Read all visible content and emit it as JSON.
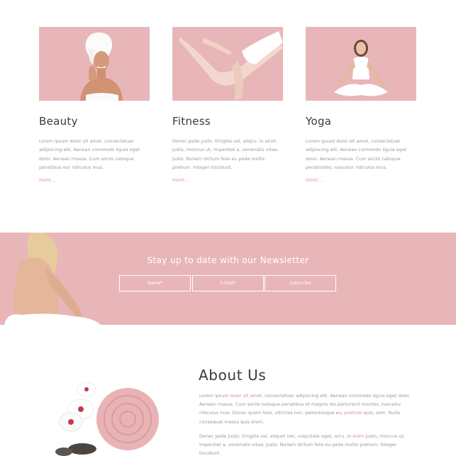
{
  "services": [
    {
      "title": "Beauty",
      "text": "Lorem ipsum dolor sit amet, consectetuer adipiscing elit. Aenean commodo ligula eget dolor. Aenean massa. Cum sociis natoque penatibus eur ridiculus mus.",
      "more": "more..."
    },
    {
      "title": "Fitness",
      "text": "Donec pede justo, fringilla vel, aliqcu. In enim justo, rhoncus ut, imperdiet a, venenatis vitae, justo. Nullam dictum felis eu pede mollis pretium. Integer tincidunt.",
      "more": "more..."
    },
    {
      "title": "Yoga",
      "text": "Lorem ipsum dolor sit amet, consectetuer adipiscing elit. Aenean commodo ligula eget dolor. Aenean massa. Cum sociis natoque penatontes; nascetur ridiculus mus.",
      "more": "more..."
    }
  ],
  "newsletter": {
    "title": "Stay up to date with our Newsletter",
    "name_placeholder": "Name*",
    "email_placeholder": "E-Mail*",
    "subscribe_label": "Subscribe"
  },
  "about": {
    "title": "About Us",
    "p1": {
      "a": "Lorem ipsum ",
      "b": "dolor sit amet",
      "c": ", consectetuer adipiscing elit. Aenean commodo ligula eget dolor. Aenean massa. Cum sociis natoque penatibus et magnis dis parturient montes, nascetur ridiculus mus. Donec quam felis, ultricies nec, pellentesque eu, ",
      "d": "pretium",
      "e": " quis, sem. Nulla consequat massa quis enim."
    },
    "p2": {
      "a": "Donec pede justo, fringilla vel, aliquet nec, vulputate eget, arcu. In ",
      "b": "enim",
      "c": " justo, rhoncus ut, imperdiet a, venenatis vitae, justo. Nullam dictum felis eu pede mollis pretium. Integer tincidunt."
    }
  },
  "colors": {
    "brand_pink": "#e8b6b8",
    "accent_link": "#d98c92"
  }
}
